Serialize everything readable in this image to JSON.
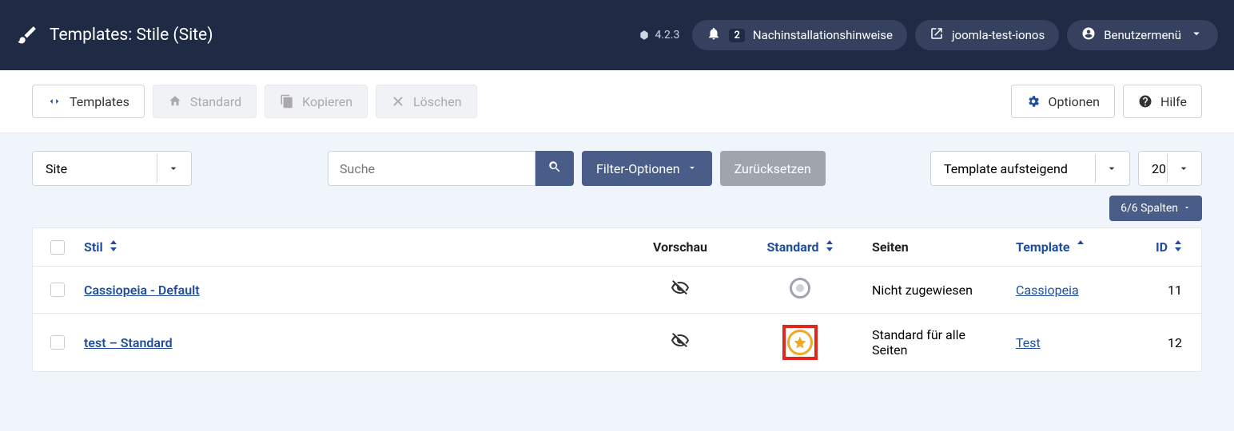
{
  "header": {
    "title": "Templates: Stile (Site)",
    "version": "4.2.3",
    "notif_count": "2",
    "pills": {
      "postinstall": "Nachinstallationshinweise",
      "sitename": "joomla-test-ionos",
      "usermenu": "Benutzermenü"
    }
  },
  "toolbar": {
    "templates": "Templates",
    "standard": "Standard",
    "copy": "Kopieren",
    "delete": "Löschen",
    "options": "Optionen",
    "help": "Hilfe"
  },
  "filters": {
    "site_select": "Site",
    "search_placeholder": "Suche",
    "filter_options": "Filter-Optionen",
    "reset": "Zurücksetzen",
    "sort_select": "Template aufsteigend",
    "limit_select": "20",
    "columns": "6/6 Spalten"
  },
  "table": {
    "headers": {
      "style": "Stil",
      "preview": "Vorschau",
      "standard": "Standard",
      "pages": "Seiten",
      "template": "Template",
      "id": "ID"
    },
    "rows": [
      {
        "style": "Cassiopeia - Default",
        "pages": "Nicht zugewiesen",
        "template": "Cassiopeia",
        "id": "11",
        "is_default": false
      },
      {
        "style": "test – Standard",
        "pages": "Standard für alle Seiten",
        "template": "Test",
        "id": "12",
        "is_default": true
      }
    ]
  }
}
